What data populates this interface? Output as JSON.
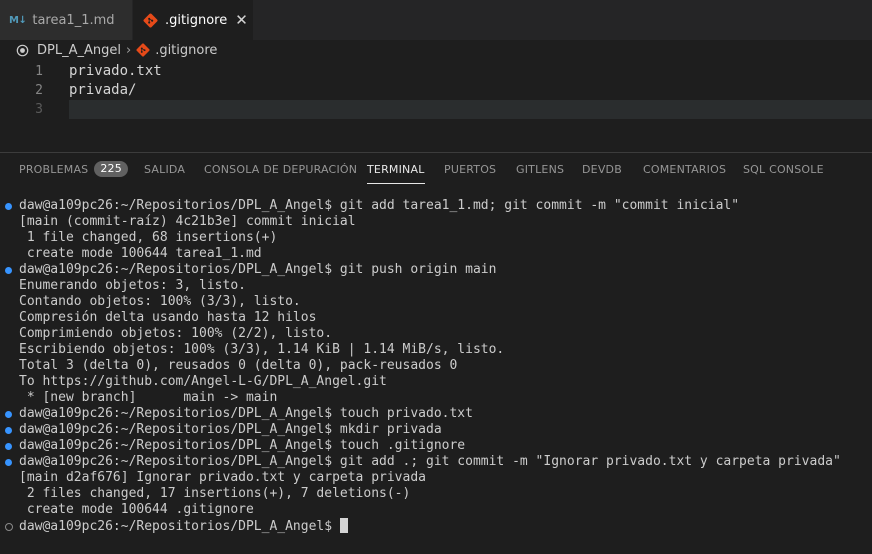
{
  "tabs": [
    {
      "label": "tarea1_1.md",
      "icon": "markdown-icon",
      "icon_text": "M↓",
      "active": false
    },
    {
      "label": ".gitignore",
      "icon": "git-icon",
      "active": true,
      "close": "✕"
    }
  ],
  "breadcrumb": {
    "root": "DPL_A_Angel",
    "separator": "›",
    "file": ".gitignore"
  },
  "editor": {
    "lines": [
      {
        "number": "1",
        "text": "privado.txt"
      },
      {
        "number": "2",
        "text": "privada/"
      },
      {
        "number": "3",
        "text": ""
      }
    ]
  },
  "panel": {
    "tabs": [
      {
        "label": "PROBLEMAS",
        "badge": "225"
      },
      {
        "label": "SALIDA"
      },
      {
        "label": "CONSOLA DE DEPURACIÓN"
      },
      {
        "label": "TERMINAL",
        "active": true
      },
      {
        "label": "PUERTOS"
      },
      {
        "label": "GITLENS"
      },
      {
        "label": "DEVDB"
      },
      {
        "label": "COMENTARIOS"
      },
      {
        "label": "SQL CONSOLE"
      }
    ]
  },
  "terminal": {
    "lines": [
      {
        "text": "daw@a109pc26:~/Repositorios/DPL_A_Angel$ git add tarea1_1.md; git commit -m \"commit inicial\"",
        "marker": "success"
      },
      {
        "text": "[main (commit-raíz) 4c21b3e] commit inicial"
      },
      {
        "text": " 1 file changed, 68 insertions(+)"
      },
      {
        "text": " create mode 100644 tarea1_1.md"
      },
      {
        "text": "daw@a109pc26:~/Repositorios/DPL_A_Angel$ git push origin main",
        "marker": "success"
      },
      {
        "text": "Enumerando objetos: 3, listo."
      },
      {
        "text": "Contando objetos: 100% (3/3), listo."
      },
      {
        "text": "Compresión delta usando hasta 12 hilos"
      },
      {
        "text": "Comprimiendo objetos: 100% (2/2), listo."
      },
      {
        "text": "Escribiendo objetos: 100% (3/3), 1.14 KiB | 1.14 MiB/s, listo."
      },
      {
        "text": "Total 3 (delta 0), reusados 0 (delta 0), pack-reusados 0"
      },
      {
        "text": "To https://github.com/Angel-L-G/DPL_A_Angel.git"
      },
      {
        "text": " * [new branch]      main -> main"
      },
      {
        "text": "daw@a109pc26:~/Repositorios/DPL_A_Angel$ touch privado.txt",
        "marker": "success"
      },
      {
        "text": "daw@a109pc26:~/Repositorios/DPL_A_Angel$ mkdir privada",
        "marker": "success"
      },
      {
        "text": "daw@a109pc26:~/Repositorios/DPL_A_Angel$ touch .gitignore",
        "marker": "success"
      },
      {
        "text": "daw@a109pc26:~/Repositorios/DPL_A_Angel$ git add .; git commit -m \"Ignorar privado.txt y carpeta privada\"",
        "marker": "success"
      },
      {
        "text": "[main d2af676] Ignorar privado.txt y carpeta privada"
      },
      {
        "text": " 2 files changed, 17 insertions(+), 7 deletions(-)"
      },
      {
        "text": " create mode 100644 .gitignore"
      },
      {
        "text": "daw@a109pc26:~/Repositorios/DPL_A_Angel$ ",
        "marker": "pending",
        "cursor": true
      }
    ]
  },
  "colors": {
    "editor_bg": "#1e1e1e",
    "tab_bar_bg": "#252526",
    "accent_blue": "#3794ff",
    "git_orange": "#e64a19",
    "md_blue": "#519aba"
  }
}
